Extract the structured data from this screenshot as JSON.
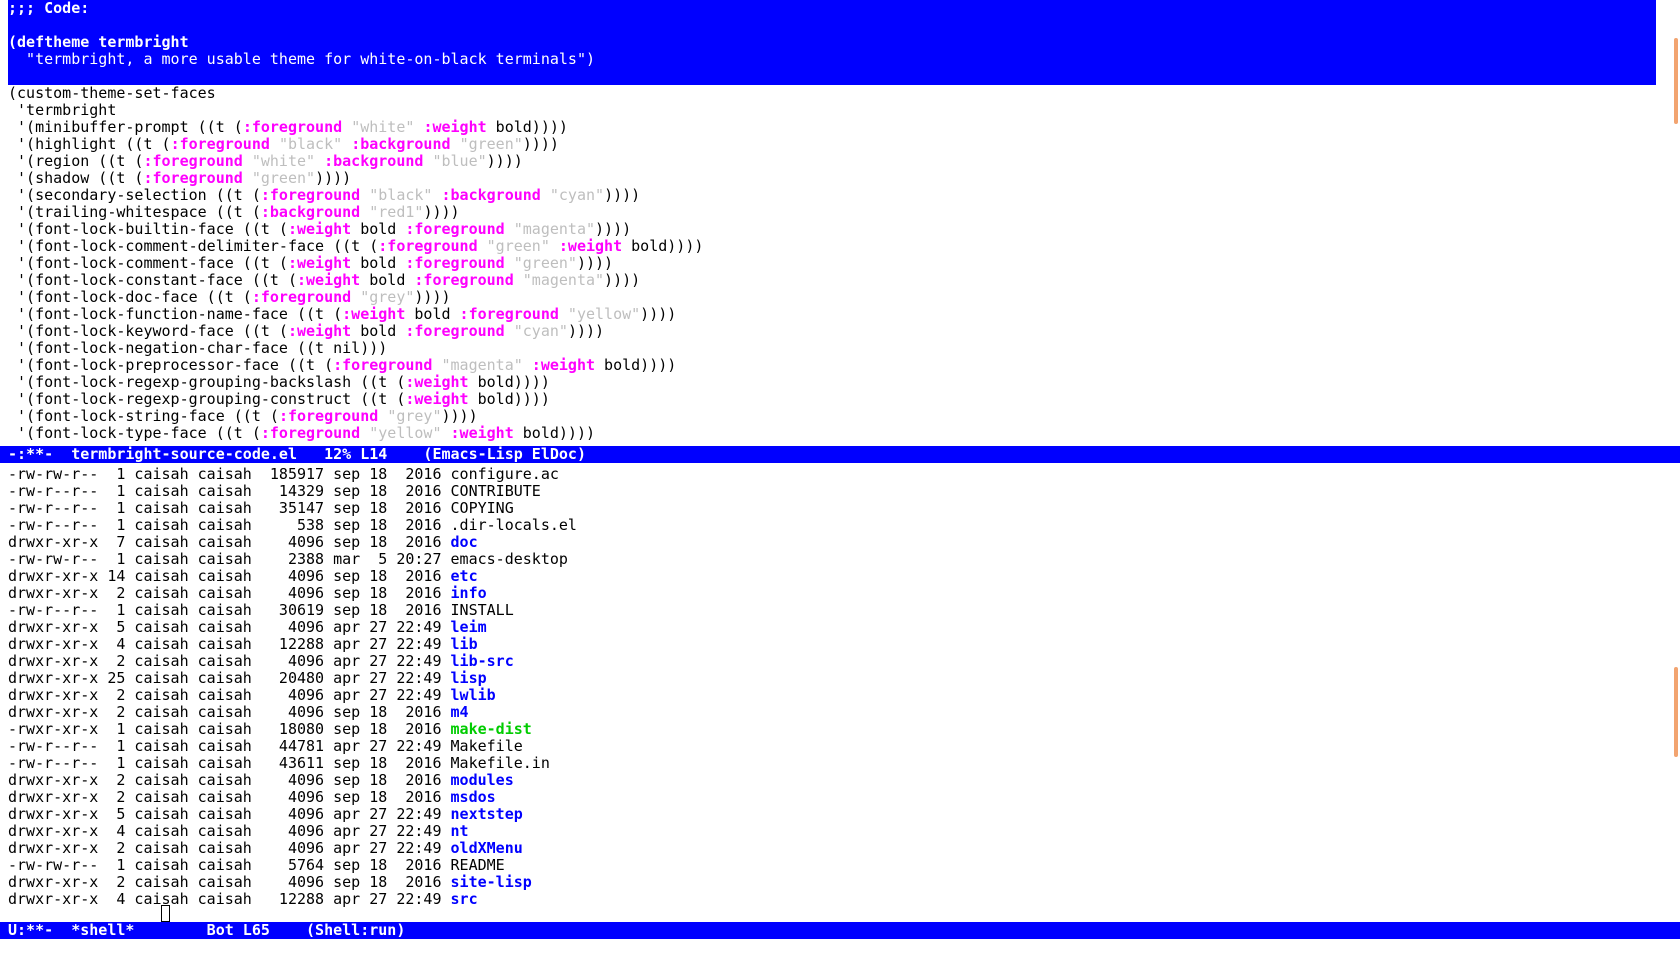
{
  "colors": {
    "modeline_bg": "#0000ff",
    "keyword": "#ff00ff",
    "string": "#bebebe",
    "directory": "#0000ff",
    "executable": "#00cc00"
  },
  "code_window": {
    "highlight_lines": [
      ";;; Code:",
      "",
      "(deftheme termbright",
      "  \"termbright, a more usable theme for white-on-black terminals\")"
    ],
    "lines": [
      [
        {
          "t": "(custom-theme-set-faces"
        }
      ],
      [
        {
          "t": " 'termbright"
        }
      ],
      [
        {
          "t": " '(minibuffer-prompt ((t ("
        },
        {
          "t": ":foreground",
          "c": "kw"
        },
        {
          "t": " "
        },
        {
          "t": "\"white\"",
          "c": "st"
        },
        {
          "t": " "
        },
        {
          "t": ":weight",
          "c": "kw"
        },
        {
          "t": " bold))))"
        }
      ],
      [
        {
          "t": " '(highlight ((t ("
        },
        {
          "t": ":foreground",
          "c": "kw"
        },
        {
          "t": " "
        },
        {
          "t": "\"black\"",
          "c": "st"
        },
        {
          "t": " "
        },
        {
          "t": ":background",
          "c": "kw"
        },
        {
          "t": " "
        },
        {
          "t": "\"green\"",
          "c": "st"
        },
        {
          "t": "))))"
        }
      ],
      [
        {
          "t": " '(region ((t ("
        },
        {
          "t": ":foreground",
          "c": "kw"
        },
        {
          "t": " "
        },
        {
          "t": "\"white\"",
          "c": "st"
        },
        {
          "t": " "
        },
        {
          "t": ":background",
          "c": "kw"
        },
        {
          "t": " "
        },
        {
          "t": "\"blue\"",
          "c": "st"
        },
        {
          "t": "))))"
        }
      ],
      [
        {
          "t": " '(shadow ((t ("
        },
        {
          "t": ":foreground",
          "c": "kw"
        },
        {
          "t": " "
        },
        {
          "t": "\"green\"",
          "c": "st"
        },
        {
          "t": "))))"
        }
      ],
      [
        {
          "t": " '(secondary-selection ((t ("
        },
        {
          "t": ":foreground",
          "c": "kw"
        },
        {
          "t": " "
        },
        {
          "t": "\"black\"",
          "c": "st"
        },
        {
          "t": " "
        },
        {
          "t": ":background",
          "c": "kw"
        },
        {
          "t": " "
        },
        {
          "t": "\"cyan\"",
          "c": "st"
        },
        {
          "t": "))))"
        }
      ],
      [
        {
          "t": " '(trailing-whitespace ((t ("
        },
        {
          "t": ":background",
          "c": "kw"
        },
        {
          "t": " "
        },
        {
          "t": "\"red1\"",
          "c": "st"
        },
        {
          "t": "))))"
        }
      ],
      [
        {
          "t": " '(font-lock-builtin-face ((t ("
        },
        {
          "t": ":weight",
          "c": "kw"
        },
        {
          "t": " bold "
        },
        {
          "t": ":foreground",
          "c": "kw"
        },
        {
          "t": " "
        },
        {
          "t": "\"magenta\"",
          "c": "st"
        },
        {
          "t": "))))"
        }
      ],
      [
        {
          "t": " '(font-lock-comment-delimiter-face ((t ("
        },
        {
          "t": ":foreground",
          "c": "kw"
        },
        {
          "t": " "
        },
        {
          "t": "\"green\"",
          "c": "st"
        },
        {
          "t": " "
        },
        {
          "t": ":weight",
          "c": "kw"
        },
        {
          "t": " bold))))"
        }
      ],
      [
        {
          "t": " '(font-lock-comment-face ((t ("
        },
        {
          "t": ":weight",
          "c": "kw"
        },
        {
          "t": " bold "
        },
        {
          "t": ":foreground",
          "c": "kw"
        },
        {
          "t": " "
        },
        {
          "t": "\"green\"",
          "c": "st"
        },
        {
          "t": "))))"
        }
      ],
      [
        {
          "t": " '(font-lock-constant-face ((t ("
        },
        {
          "t": ":weight",
          "c": "kw"
        },
        {
          "t": " bold "
        },
        {
          "t": ":foreground",
          "c": "kw"
        },
        {
          "t": " "
        },
        {
          "t": "\"magenta\"",
          "c": "st"
        },
        {
          "t": "))))"
        }
      ],
      [
        {
          "t": " '(font-lock-doc-face ((t ("
        },
        {
          "t": ":foreground",
          "c": "kw"
        },
        {
          "t": " "
        },
        {
          "t": "\"grey\"",
          "c": "st"
        },
        {
          "t": "))))"
        }
      ],
      [
        {
          "t": " '(font-lock-function-name-face ((t ("
        },
        {
          "t": ":weight",
          "c": "kw"
        },
        {
          "t": " bold "
        },
        {
          "t": ":foreground",
          "c": "kw"
        },
        {
          "t": " "
        },
        {
          "t": "\"yellow\"",
          "c": "st"
        },
        {
          "t": "))))"
        }
      ],
      [
        {
          "t": " '(font-lock-keyword-face ((t ("
        },
        {
          "t": ":weight",
          "c": "kw"
        },
        {
          "t": " bold "
        },
        {
          "t": ":foreground",
          "c": "kw"
        },
        {
          "t": " "
        },
        {
          "t": "\"cyan\"",
          "c": "st"
        },
        {
          "t": "))))"
        }
      ],
      [
        {
          "t": " '(font-lock-negation-char-face ((t nil)))"
        }
      ],
      [
        {
          "t": " '(font-lock-preprocessor-face ((t ("
        },
        {
          "t": ":foreground",
          "c": "kw"
        },
        {
          "t": " "
        },
        {
          "t": "\"magenta\"",
          "c": "st"
        },
        {
          "t": " "
        },
        {
          "t": ":weight",
          "c": "kw"
        },
        {
          "t": " bold))))"
        }
      ],
      [
        {
          "t": " '(font-lock-regexp-grouping-backslash ((t ("
        },
        {
          "t": ":weight",
          "c": "kw"
        },
        {
          "t": " bold))))"
        }
      ],
      [
        {
          "t": " '(font-lock-regexp-grouping-construct ((t ("
        },
        {
          "t": ":weight",
          "c": "kw"
        },
        {
          "t": " bold))))"
        }
      ],
      [
        {
          "t": " '(font-lock-string-face ((t ("
        },
        {
          "t": ":foreground",
          "c": "kw"
        },
        {
          "t": " "
        },
        {
          "t": "\"grey\"",
          "c": "st"
        },
        {
          "t": "))))"
        }
      ],
      [
        {
          "t": " '(font-lock-type-face ((t ("
        },
        {
          "t": ":foreground",
          "c": "kw"
        },
        {
          "t": " "
        },
        {
          "t": "\"yellow\"",
          "c": "st"
        },
        {
          "t": " "
        },
        {
          "t": ":weight",
          "c": "kw"
        },
        {
          "t": " bold))))"
        }
      ]
    ],
    "modeline": "-:**-  termbright-source-code.el   12% L14    (Emacs-Lisp ElDoc)"
  },
  "shell_window": {
    "rows": [
      {
        "prefix": "-rw-rw-r--  1 caisah caisah  185917 sep 18  2016 ",
        "name": "configure.ac",
        "kind": "file"
      },
      {
        "prefix": "-rw-r--r--  1 caisah caisah   14329 sep 18  2016 ",
        "name": "CONTRIBUTE",
        "kind": "file"
      },
      {
        "prefix": "-rw-r--r--  1 caisah caisah   35147 sep 18  2016 ",
        "name": "COPYING",
        "kind": "file"
      },
      {
        "prefix": "-rw-r--r--  1 caisah caisah     538 sep 18  2016 ",
        "name": ".dir-locals.el",
        "kind": "file"
      },
      {
        "prefix": "drwxr-xr-x  7 caisah caisah    4096 sep 18  2016 ",
        "name": "doc",
        "kind": "dir"
      },
      {
        "prefix": "-rw-rw-r--  1 caisah caisah    2388 mar  5 20:27 ",
        "name": "emacs-desktop",
        "kind": "file"
      },
      {
        "prefix": "drwxr-xr-x 14 caisah caisah    4096 sep 18  2016 ",
        "name": "etc",
        "kind": "dir"
      },
      {
        "prefix": "drwxr-xr-x  2 caisah caisah    4096 sep 18  2016 ",
        "name": "info",
        "kind": "dir"
      },
      {
        "prefix": "-rw-r--r--  1 caisah caisah   30619 sep 18  2016 ",
        "name": "INSTALL",
        "kind": "file"
      },
      {
        "prefix": "drwxr-xr-x  5 caisah caisah    4096 apr 27 22:49 ",
        "name": "leim",
        "kind": "dir"
      },
      {
        "prefix": "drwxr-xr-x  4 caisah caisah   12288 apr 27 22:49 ",
        "name": "lib",
        "kind": "dir"
      },
      {
        "prefix": "drwxr-xr-x  2 caisah caisah    4096 apr 27 22:49 ",
        "name": "lib-src",
        "kind": "dir"
      },
      {
        "prefix": "drwxr-xr-x 25 caisah caisah   20480 apr 27 22:49 ",
        "name": "lisp",
        "kind": "dir"
      },
      {
        "prefix": "drwxr-xr-x  2 caisah caisah    4096 apr 27 22:49 ",
        "name": "lwlib",
        "kind": "dir"
      },
      {
        "prefix": "drwxr-xr-x  2 caisah caisah    4096 sep 18  2016 ",
        "name": "m4",
        "kind": "dir"
      },
      {
        "prefix": "-rwxr-xr-x  1 caisah caisah   18080 sep 18  2016 ",
        "name": "make-dist",
        "kind": "exe"
      },
      {
        "prefix": "-rw-r--r--  1 caisah caisah   44781 apr 27 22:49 ",
        "name": "Makefile",
        "kind": "file"
      },
      {
        "prefix": "-rw-r--r--  1 caisah caisah   43611 sep 18  2016 ",
        "name": "Makefile.in",
        "kind": "file"
      },
      {
        "prefix": "drwxr-xr-x  2 caisah caisah    4096 sep 18  2016 ",
        "name": "modules",
        "kind": "dir"
      },
      {
        "prefix": "drwxr-xr-x  2 caisah caisah    4096 sep 18  2016 ",
        "name": "msdos",
        "kind": "dir"
      },
      {
        "prefix": "drwxr-xr-x  5 caisah caisah    4096 apr 27 22:49 ",
        "name": "nextstep",
        "kind": "dir"
      },
      {
        "prefix": "drwxr-xr-x  4 caisah caisah    4096 apr 27 22:49 ",
        "name": "nt",
        "kind": "dir"
      },
      {
        "prefix": "drwxr-xr-x  2 caisah caisah    4096 apr 27 22:49 ",
        "name": "oldXMenu",
        "kind": "dir"
      },
      {
        "prefix": "-rw-rw-r--  1 caisah caisah    5764 sep 18  2016 ",
        "name": "README",
        "kind": "file"
      },
      {
        "prefix": "drwxr-xr-x  2 caisah caisah    4096 sep 18  2016 ",
        "name": "site-lisp",
        "kind": "dir"
      },
      {
        "prefix": "drwxr-xr-x  4 caisah caisah   12288 apr 27 22:49 ",
        "name": "src",
        "kind": "dir"
      }
    ],
    "modeline": "U:**-  *shell*        Bot L65    (Shell:run)"
  }
}
